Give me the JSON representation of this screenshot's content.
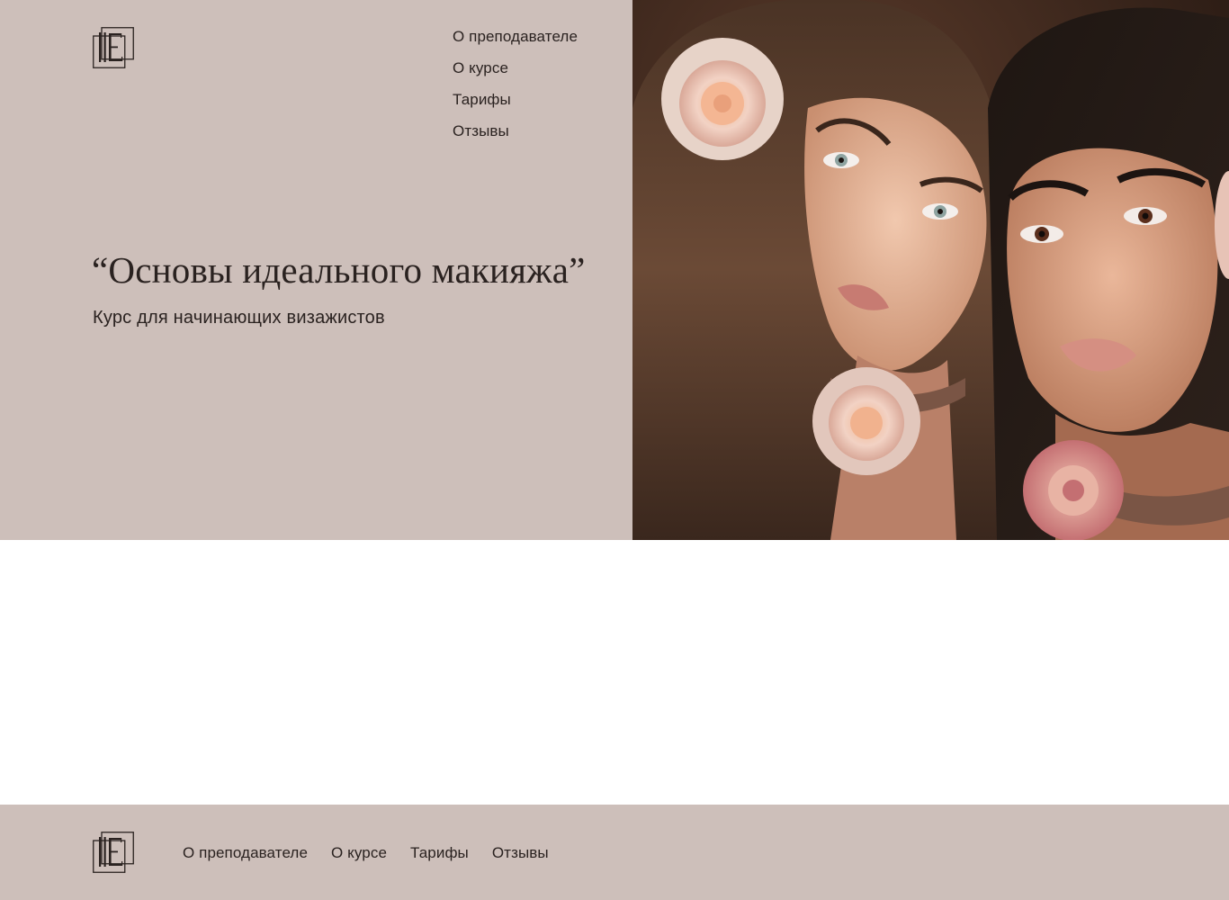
{
  "nav": {
    "items": [
      {
        "label": "О преподавателе"
      },
      {
        "label": "О курсе"
      },
      {
        "label": "Тарифы"
      },
      {
        "label": "Отзывы"
      }
    ]
  },
  "hero": {
    "title": "“Основы идеального макияжа”",
    "subtitle": "Курс для начинающих визажистов"
  },
  "footer": {
    "nav": [
      {
        "label": "О преподавателе"
      },
      {
        "label": "О курсе"
      },
      {
        "label": "Тарифы"
      },
      {
        "label": "Отзывы"
      }
    ]
  },
  "colors": {
    "accent_bg": "#cdbfba",
    "text": "#2a2220",
    "page_bg": "#ffffff"
  },
  "icons": {
    "logo": "monogram-logo-icon"
  }
}
